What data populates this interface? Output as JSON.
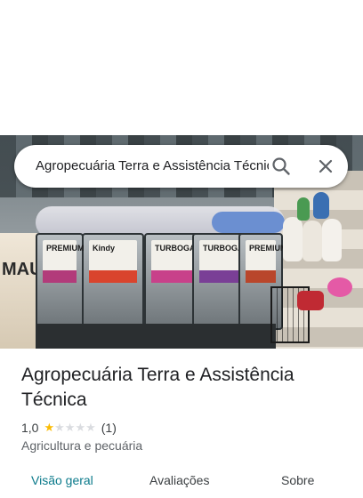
{
  "search": {
    "query": "Agropecuária Terra e Assistência Técnica"
  },
  "place": {
    "name": "Agropecuária Terra e Assistência Técnica",
    "rating": "1,0",
    "rating_fraction": 0.2,
    "review_count": "(1)",
    "category": "Agricultura e pecuária"
  },
  "photo": {
    "visible_brand_text": [
      "Kindy",
      "TURBOGAN",
      "TURBOGAN",
      "PREMIUM",
      "PREMIUM"
    ]
  },
  "tabs": [
    {
      "label": "Visão geral",
      "active": true
    },
    {
      "label": "Avaliações",
      "active": false
    },
    {
      "label": "Sobre",
      "active": false
    }
  ],
  "colors": {
    "star_full": "#fbbc04",
    "star_empty": "#dadce0",
    "active_tab": "#0b7a8b"
  },
  "icons": {
    "search": "search-icon",
    "close": "close-icon"
  }
}
